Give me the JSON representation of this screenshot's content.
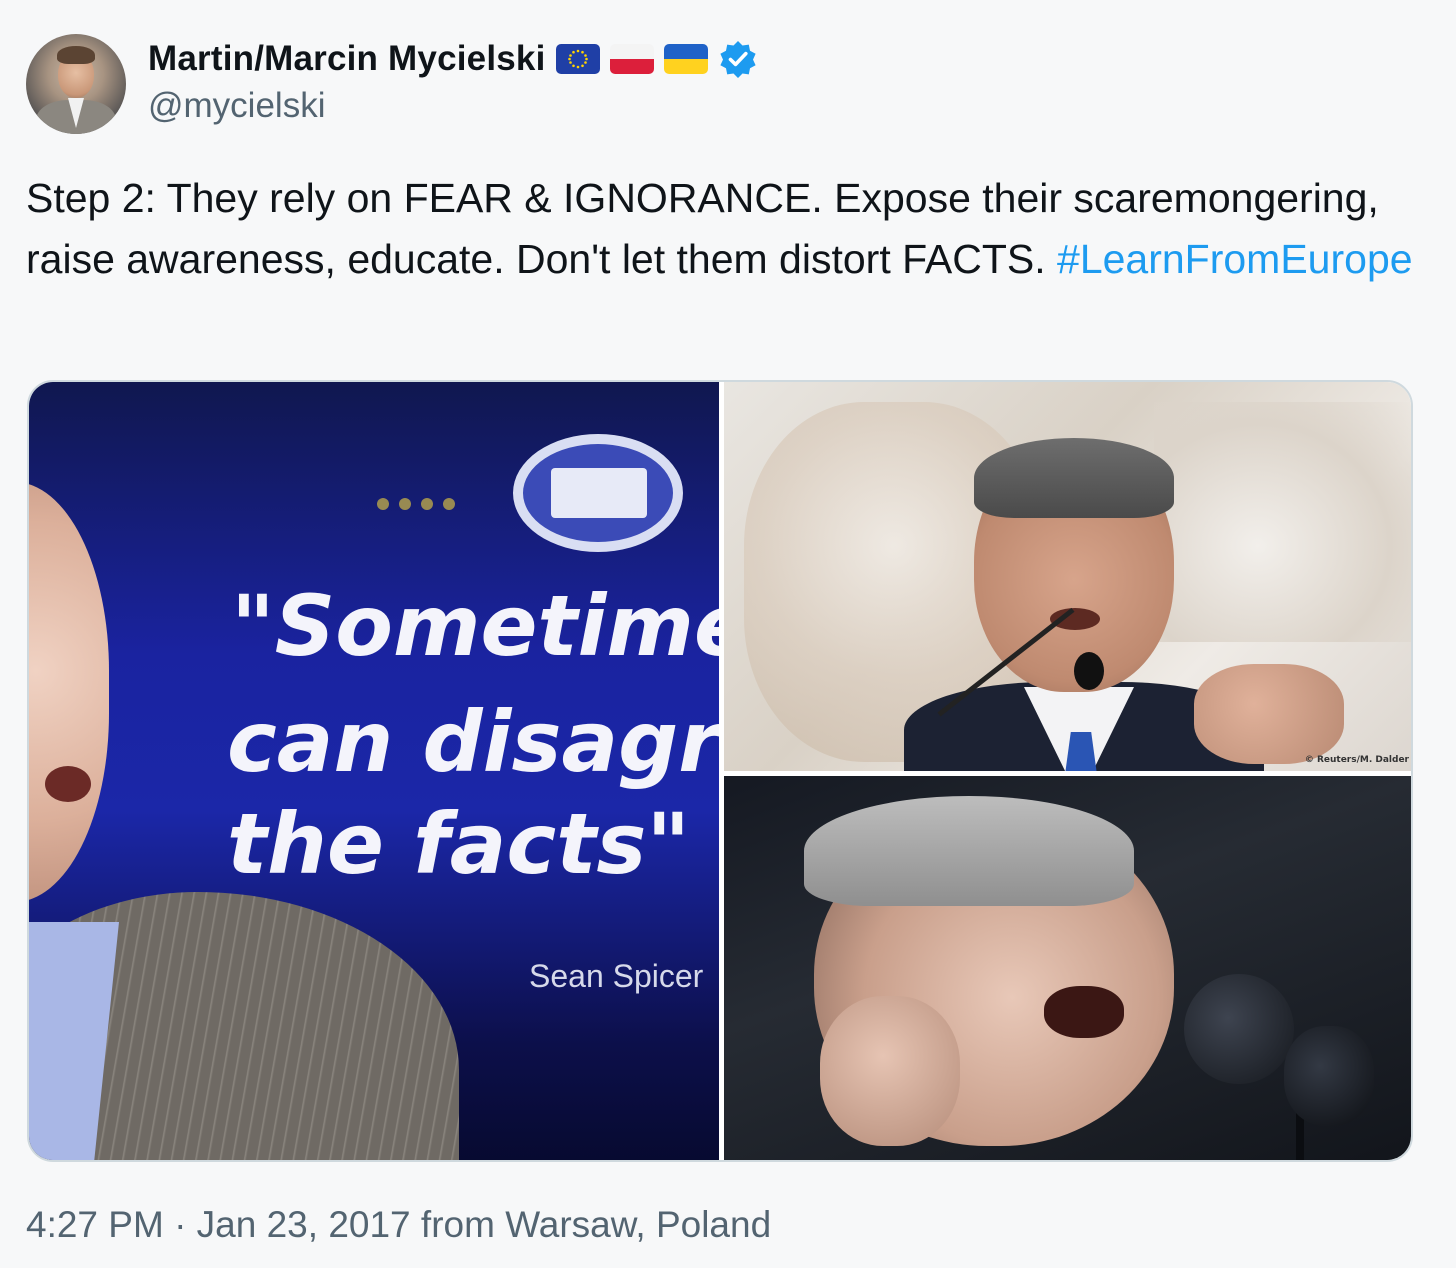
{
  "author": {
    "display_name": "Martin/Marcin Mycielski",
    "handle": "@mycielski",
    "flags": [
      "eu-flag-icon",
      "poland-flag-icon",
      "ukraine-flag-icon"
    ],
    "verified": true
  },
  "tweet": {
    "text": "Step 2: They rely on FEAR & IGNORANCE. Expose their scaremongering, raise awareness, educate. Don't let them distort FACTS. ",
    "hashtag": "#LearnFromEurope"
  },
  "media": {
    "left_image": {
      "quote_line1": "\"Sometime",
      "quote_line2": "can disagre",
      "quote_line3": "the facts\"",
      "attribution": "Sean Spicer"
    },
    "top_right_image": {
      "credit": "© Reuters/M. Dalder"
    }
  },
  "meta": {
    "timestamp": "4:27 PM · Jan 23, 2017 from Warsaw, Poland"
  },
  "colors": {
    "hashtag": "#1d9bf0",
    "secondary_text": "#536471",
    "verified": "#1d9bf0"
  }
}
